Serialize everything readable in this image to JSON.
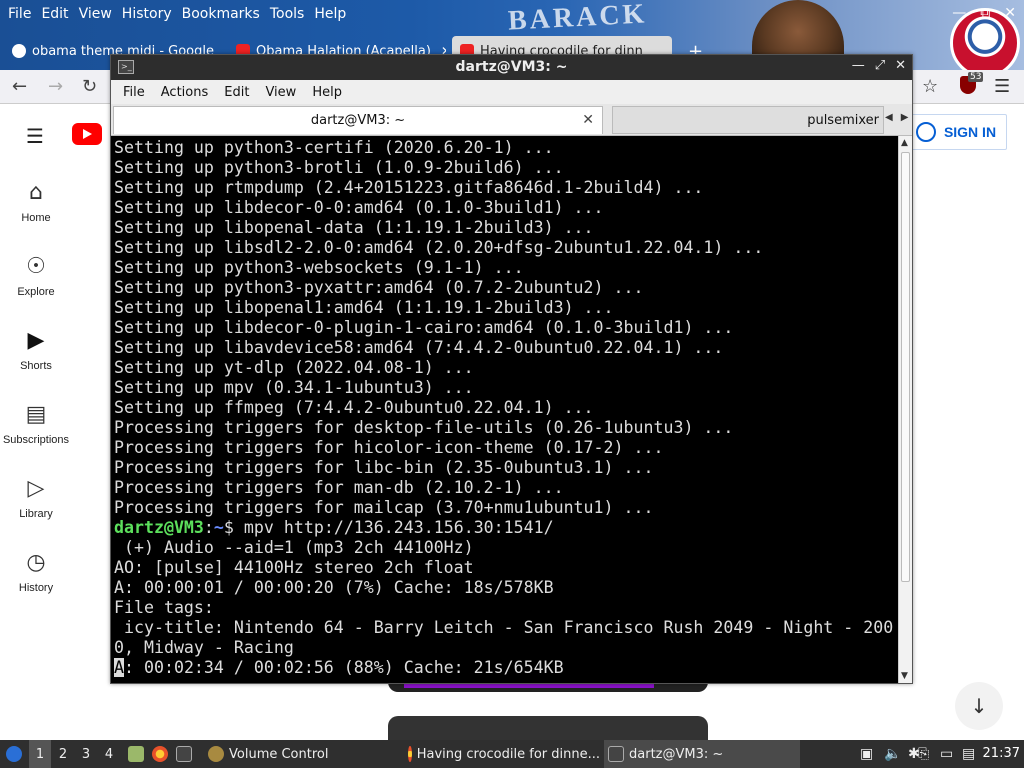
{
  "browser": {
    "menu": [
      "File",
      "Edit",
      "View",
      "History",
      "Bookmarks",
      "Tools",
      "Help"
    ],
    "theme_text": "BARACK",
    "tabs": [
      {
        "title": "obama theme midi - Google"
      },
      {
        "title": "Obama Halation (Acapella)"
      },
      {
        "title": "Having crocodile for dinn"
      }
    ],
    "ublock_count": "53"
  },
  "youtube": {
    "sidebar": [
      {
        "label": "Home",
        "icon": "home-icon"
      },
      {
        "label": "Explore",
        "icon": "compass-icon"
      },
      {
        "label": "Shorts",
        "icon": "shorts-icon"
      },
      {
        "label": "Subscriptions",
        "icon": "subscriptions-icon"
      },
      {
        "label": "Library",
        "icon": "library-icon"
      },
      {
        "label": "History",
        "icon": "history-icon"
      }
    ],
    "sign_in": "SIGN IN"
  },
  "terminal": {
    "title": "dartz@VM3: ~",
    "menu": [
      "File",
      "Actions",
      "Edit",
      "View",
      "Help"
    ],
    "tabs": [
      {
        "title": "dartz@VM3: ~"
      },
      {
        "title": "pulsemixer"
      }
    ],
    "lines_before": [
      "Setting up python3-certifi (2020.6.20-1) ...",
      "Setting up python3-brotli (1.0.9-2build6) ...",
      "Setting up rtmpdump (2.4+20151223.gitfa8646d.1-2build4) ...",
      "Setting up libdecor-0-0:amd64 (0.1.0-3build1) ...",
      "Setting up libopenal-data (1:1.19.1-2build3) ...",
      "Setting up libsdl2-2.0-0:amd64 (2.0.20+dfsg-2ubuntu1.22.04.1) ...",
      "Setting up python3-websockets (9.1-1) ...",
      "Setting up python3-pyxattr:amd64 (0.7.2-2ubuntu2) ...",
      "Setting up libopenal1:amd64 (1:1.19.1-2build3) ...",
      "Setting up libdecor-0-plugin-1-cairo:amd64 (0.1.0-3build1) ...",
      "Setting up libavdevice58:amd64 (7:4.4.2-0ubuntu0.22.04.1) ...",
      "Setting up yt-dlp (2022.04.08-1) ...",
      "Setting up mpv (0.34.1-1ubuntu3) ...",
      "Setting up ffmpeg (7:4.4.2-0ubuntu0.22.04.1) ...",
      "Processing triggers for desktop-file-utils (0.26-1ubuntu3) ...",
      "Processing triggers for hicolor-icon-theme (0.17-2) ...",
      "Processing triggers for libc-bin (2.35-0ubuntu3.1) ...",
      "Processing triggers for man-db (2.10.2-1) ...",
      "Processing triggers for mailcap (3.70+nmu1ubuntu1) ..."
    ],
    "prompt_user": "dartz@VM3",
    "prompt_sep": ":",
    "prompt_path": "~",
    "prompt_dollar": "$",
    "command": " mpv http://136.243.156.30:1541/",
    "lines_after": [
      " (+) Audio --aid=1 (mp3 2ch 44100Hz)",
      "AO: [pulse] 44100Hz stereo 2ch float",
      "A: 00:00:01 / 00:00:20 (7%) Cache: 18s/578KB",
      "File tags:",
      " icy-title: Nintendo 64 - Barry Leitch - San Francisco Rush 2049 - Night - 200",
      "0, Midway - Racing"
    ],
    "status_cursor": "A",
    "status_rest": ": 00:02:34 / 00:02:56 (88%) Cache: 21s/654KB"
  },
  "taskbar": {
    "workspaces": [
      "1",
      "2",
      "3",
      "4"
    ],
    "tasks": [
      {
        "title": "Volume Control"
      },
      {
        "title": "Having crocodile for dinne..."
      },
      {
        "title": "dartz@VM3: ~"
      }
    ],
    "clock": "21:37"
  },
  "colors": {
    "terminal_bg": "#000000",
    "terminal_fg": "#dcdcdc",
    "prompt_user": "#5ce05c",
    "prompt_path": "#6a8cff",
    "youtube_red": "#ff0000",
    "signin_blue": "#065fd4"
  }
}
